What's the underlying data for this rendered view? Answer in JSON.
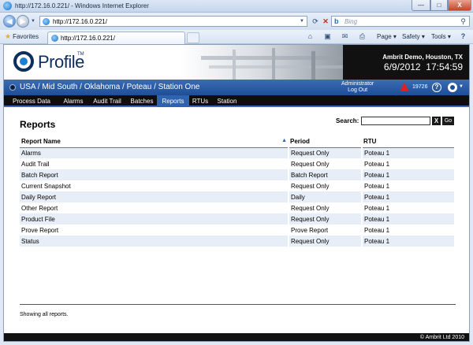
{
  "window": {
    "title": "http://172.16.0.221/ - Windows Internet Explorer",
    "minimize": "—",
    "maximize": "□",
    "close": "X"
  },
  "address_bar": {
    "url": "http://172.16.0.221/",
    "search_placeholder": "Bing"
  },
  "favorites_bar": {
    "favorites_label": "Favorites",
    "tab_title": "http://172.16.0.221/",
    "commands": {
      "page": "Page ▾",
      "safety": "Safety ▾",
      "tools": "Tools ▾"
    }
  },
  "header": {
    "logo": "Profile",
    "logo_tm": "TM",
    "site_name": "Ambrit Demo, Houston, TX",
    "date": "6/9/2012",
    "time": "17:54:59"
  },
  "location_bar": {
    "breadcrumb": "USA / Mid South / Oklahoma / Poteau / Station One",
    "user": "Administrator",
    "logout": "Log Out",
    "alarm_count": "19726",
    "help": "?"
  },
  "menu": {
    "items": [
      {
        "label": "Process Data"
      },
      {
        "label": "Alarms"
      },
      {
        "label": "Audit Trail"
      },
      {
        "label": "Batches"
      },
      {
        "label": "Reports",
        "active": true
      },
      {
        "label": "RTUs"
      },
      {
        "label": "Station"
      }
    ]
  },
  "reports": {
    "title": "Reports",
    "search_label": "Search:",
    "search_value": "",
    "clear_label": "X",
    "go_label": "Go",
    "columns": [
      "Report Name",
      "Period",
      "RTU"
    ],
    "rows": [
      [
        "Alarms",
        "Request Only",
        "Poteau 1"
      ],
      [
        "Audit Trail",
        "Request Only",
        "Poteau 1"
      ],
      [
        "Batch Report",
        "Batch Report",
        "Poteau 1"
      ],
      [
        "Current Snapshot",
        "Request Only",
        "Poteau 1"
      ],
      [
        "Daily Report",
        "Daily",
        "Poteau 1"
      ],
      [
        "Other Report",
        "Request Only",
        "Poteau 1"
      ],
      [
        "Product File",
        "Request Only",
        "Poteau 1"
      ],
      [
        "Prove Report",
        "Prove Report",
        "Poteau 1"
      ],
      [
        "Status",
        "Request Only",
        "Poteau 1"
      ]
    ],
    "status": "Showing all reports."
  },
  "footer": {
    "copyright": "© Ambrit Ltd 2010"
  },
  "colors": {
    "accent_blue": "#2f63b0",
    "header_navy": "#0d2e5e",
    "menu_black": "#0e0e0e",
    "alarm_red": "#e02020"
  }
}
